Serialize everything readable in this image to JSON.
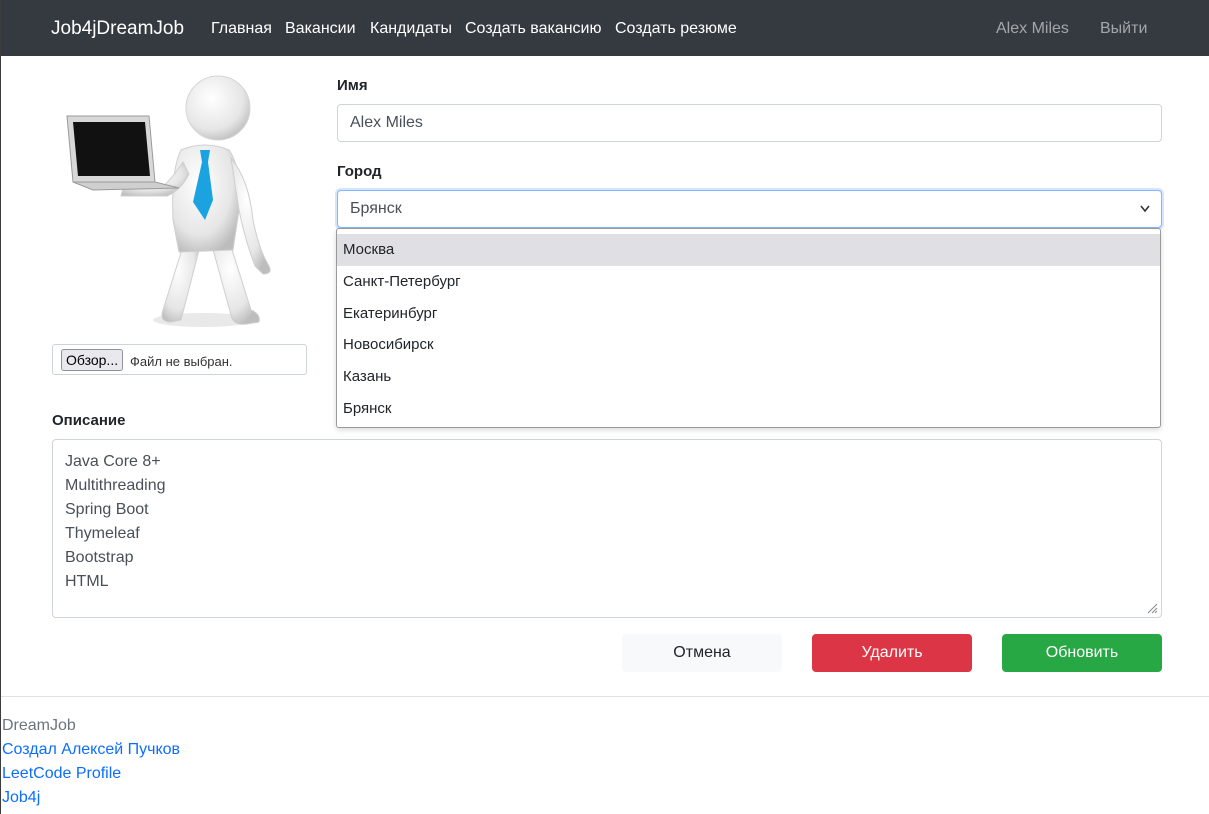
{
  "navbar": {
    "brand": "Job4jDreamJob",
    "links": [
      "Главная",
      "Вакансии",
      "Кандидаты",
      "Создать вакансию",
      "Создать резюме"
    ],
    "user": "Alex Miles",
    "logout": "Выйти"
  },
  "photo": {
    "browse_label": "Обзор...",
    "file_status": "Файл не выбран."
  },
  "form": {
    "name_label": "Имя",
    "name_value": "Alex Miles",
    "city_label": "Город",
    "city_value": "Брянск",
    "city_options": [
      "Москва",
      "Санкт-Петербург",
      "Екатеринбург",
      "Новосибирск",
      "Казань",
      "Брянск"
    ],
    "highlighted_option": "Москва",
    "description_label": "Описание",
    "description_lines": [
      "Java Core 8+",
      "Multithreading",
      "Spring Boot",
      "Thymeleaf",
      "Bootstrap",
      "HTML"
    ]
  },
  "buttons": {
    "cancel": "Отмена",
    "delete": "Удалить",
    "update": "Обновить"
  },
  "footer": {
    "title": "DreamJob",
    "links": [
      "Создал Алексей Пучков",
      "LeetCode Profile",
      "Job4j"
    ]
  },
  "colors": {
    "navbar_bg": "#343a40",
    "danger": "#dc3545",
    "success": "#28a745",
    "link": "#0d6efd",
    "tie": "#1aa3e0"
  },
  "icons": {
    "select_chevron": "chevron-down-icon",
    "avatar": "person-with-laptop-illustration",
    "resize_grip": "resize-grip-icon"
  }
}
